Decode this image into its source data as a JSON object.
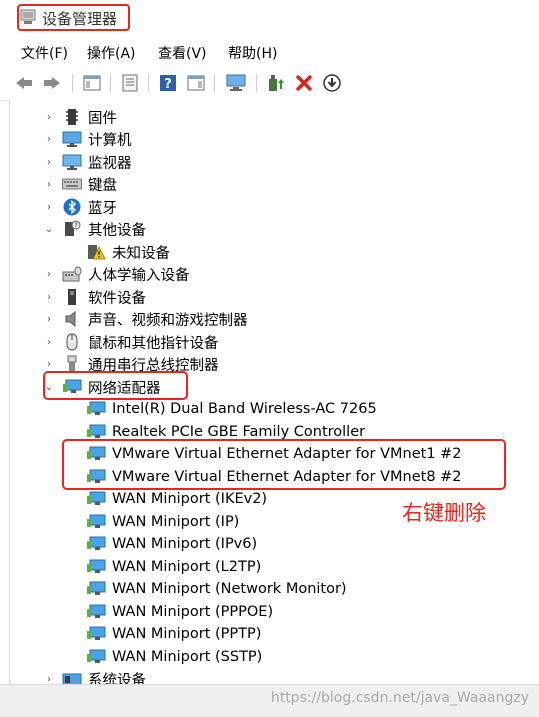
{
  "window": {
    "title": "设备管理器"
  },
  "menu": [
    "文件(F)",
    "操作(A)",
    "查看(V)",
    "帮助(H)"
  ],
  "toolbar": {
    "buttons": [
      "back-icon",
      "forward-icon",
      "show-hide-console-tree-icon",
      "properties-icon",
      "help-icon",
      "action-pane-icon",
      "scan-hardware-icon",
      "update-driver-icon",
      "uninstall-icon",
      "disable-icon"
    ]
  },
  "tree": {
    "top_items": [
      {
        "label": "固件",
        "icon": "firmware-icon",
        "expanded": false
      },
      {
        "label": "计算机",
        "icon": "computer-icon",
        "expanded": false
      },
      {
        "label": "监视器",
        "icon": "monitor-icon",
        "expanded": false
      },
      {
        "label": "键盘",
        "icon": "keyboard-icon",
        "expanded": false
      },
      {
        "label": "蓝牙",
        "icon": "bluetooth-icon",
        "expanded": false
      },
      {
        "label": "其他设备",
        "icon": "other-devices-icon",
        "expanded": true
      }
    ],
    "other_children": [
      {
        "label": "未知设备",
        "icon": "unknown-device-warning-icon"
      }
    ],
    "mid_items": [
      {
        "label": "人体学输入设备",
        "icon": "hid-icon",
        "expanded": false
      },
      {
        "label": "软件设备",
        "icon": "software-device-icon",
        "expanded": false
      },
      {
        "label": "声音、视频和游戏控制器",
        "icon": "speaker-icon",
        "expanded": false
      },
      {
        "label": "鼠标和其他指针设备",
        "icon": "mouse-icon",
        "expanded": false
      },
      {
        "label": "通用串行总线控制器",
        "icon": "usb-icon",
        "expanded": false
      }
    ],
    "network": {
      "label": "网络适配器",
      "icon": "network-adapter-icon",
      "expanded": true,
      "children": [
        "Intel(R) Dual Band Wireless-AC 7265",
        "Realtek PCIe GBE Family Controller",
        "VMware Virtual Ethernet Adapter for VMnet1 #2",
        "VMware Virtual Ethernet Adapter for VMnet8 #2",
        "WAN Miniport (IKEv2)",
        "WAN Miniport (IP)",
        "WAN Miniport (IPv6)",
        "WAN Miniport (L2TP)",
        "WAN Miniport (Network Monitor)",
        "WAN Miniport (PPPOE)",
        "WAN Miniport (PPTP)",
        "WAN Miniport (SSTP)"
      ]
    },
    "bottom_items": [
      {
        "label": "系统设备",
        "icon": "system-device-icon",
        "expanded": false
      }
    ]
  },
  "annotation": {
    "text": "右键删除",
    "color": "#e8261f"
  },
  "watermark": "https://blog.csdn.net/java_Waaangzy",
  "colors": {
    "highlight": "#e8261f",
    "adapter_blue": "#3a8fd6"
  }
}
